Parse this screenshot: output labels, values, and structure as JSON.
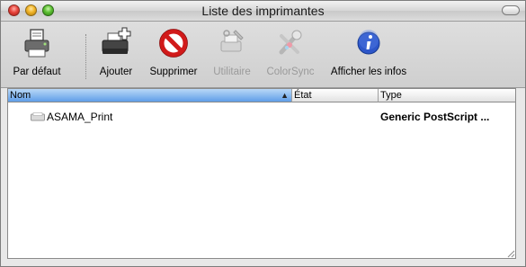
{
  "window": {
    "title": "Liste des imprimantes"
  },
  "toolbar": {
    "items": [
      {
        "label": "Par défaut",
        "icon": "printer-default-icon",
        "enabled": true
      },
      {
        "label": "Ajouter",
        "icon": "printer-add-icon",
        "enabled": true
      },
      {
        "label": "Supprimer",
        "icon": "delete-prohibited-icon",
        "enabled": true
      },
      {
        "label": "Utilitaire",
        "icon": "utility-icon",
        "enabled": false
      },
      {
        "label": "ColorSync",
        "icon": "colorsync-icon",
        "enabled": false
      },
      {
        "label": "Afficher les infos",
        "icon": "info-icon",
        "enabled": true
      }
    ]
  },
  "table": {
    "columns": [
      {
        "label": "Nom",
        "sorted": true,
        "sort_direction": "ascending"
      },
      {
        "label": "État",
        "sorted": false
      },
      {
        "label": "Type",
        "sorted": false
      }
    ],
    "rows": [
      {
        "name": "ASAMA_Print",
        "status": "",
        "type": "Generic PostScript ..."
      }
    ]
  },
  "colors": {
    "sorted_header": "#5f9ee8",
    "supprimer_red": "#d11a1a",
    "info_blue": "#2d56c9"
  }
}
